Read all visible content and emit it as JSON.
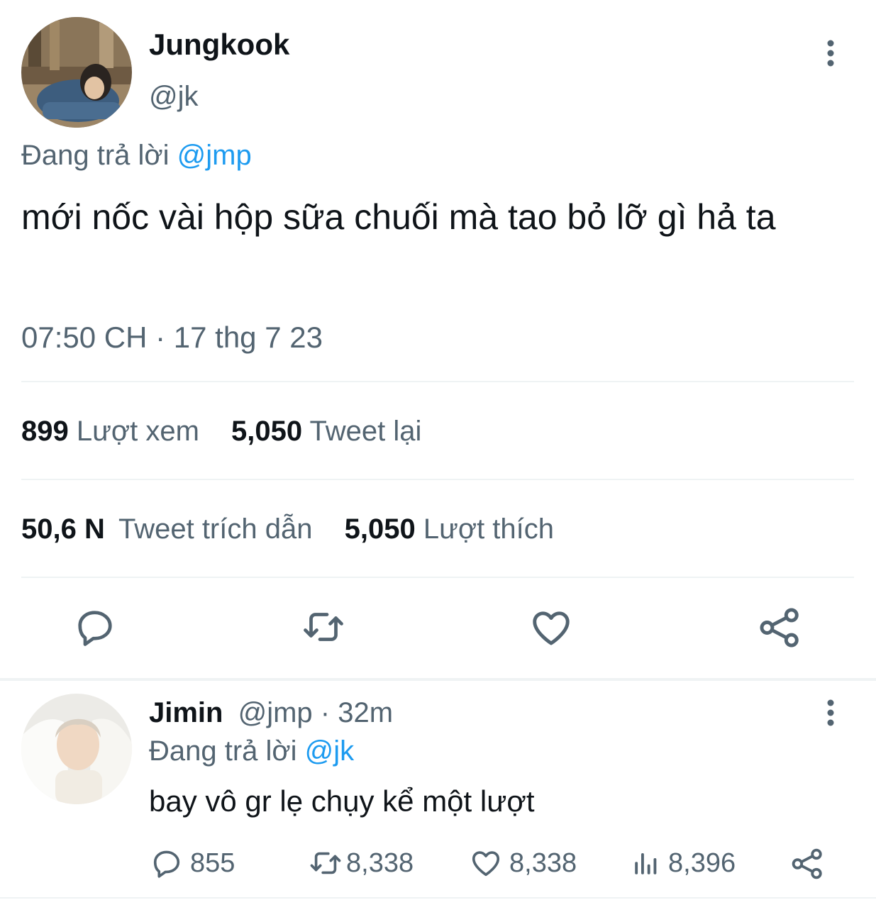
{
  "main_tweet": {
    "author_name": "Jungkook",
    "author_handle": "@jk",
    "replying_prefix": "Đang trả lời",
    "replying_to": "@jmp",
    "text": "mới nốc vài hộp sữa chuối mà tao bỏ lỡ gì hả ta",
    "timestamp": "07:50 CH · 17 thg 7 23",
    "stats": {
      "views_count": "899",
      "views_label": "Lượt xem",
      "retweets_count": "5,050",
      "retweets_label": "Tweet lại",
      "quotes_count": "50,6 N",
      "quotes_label": "Tweet trích dẫn",
      "likes_count": "5,050",
      "likes_label": "Lượt thích"
    },
    "actions": [
      "reply-icon",
      "retweet-icon",
      "like-icon",
      "share-icon"
    ]
  },
  "reply_tweet": {
    "author_name": "Jimin",
    "author_handle": "@jmp",
    "separator": "·",
    "time_ago": "32m",
    "replying_prefix": "Đang trả lời",
    "replying_to": "@jk",
    "text": "bay vô gr lẹ chụy kể một lượt",
    "actions": {
      "reply_count": "855",
      "retweet_count": "8,338",
      "like_count": "8,338",
      "views_count": "8,396"
    }
  },
  "colors": {
    "link": "#1d9bf0",
    "muted": "#536471",
    "text": "#0f1419",
    "divider": "#eff3f4"
  }
}
